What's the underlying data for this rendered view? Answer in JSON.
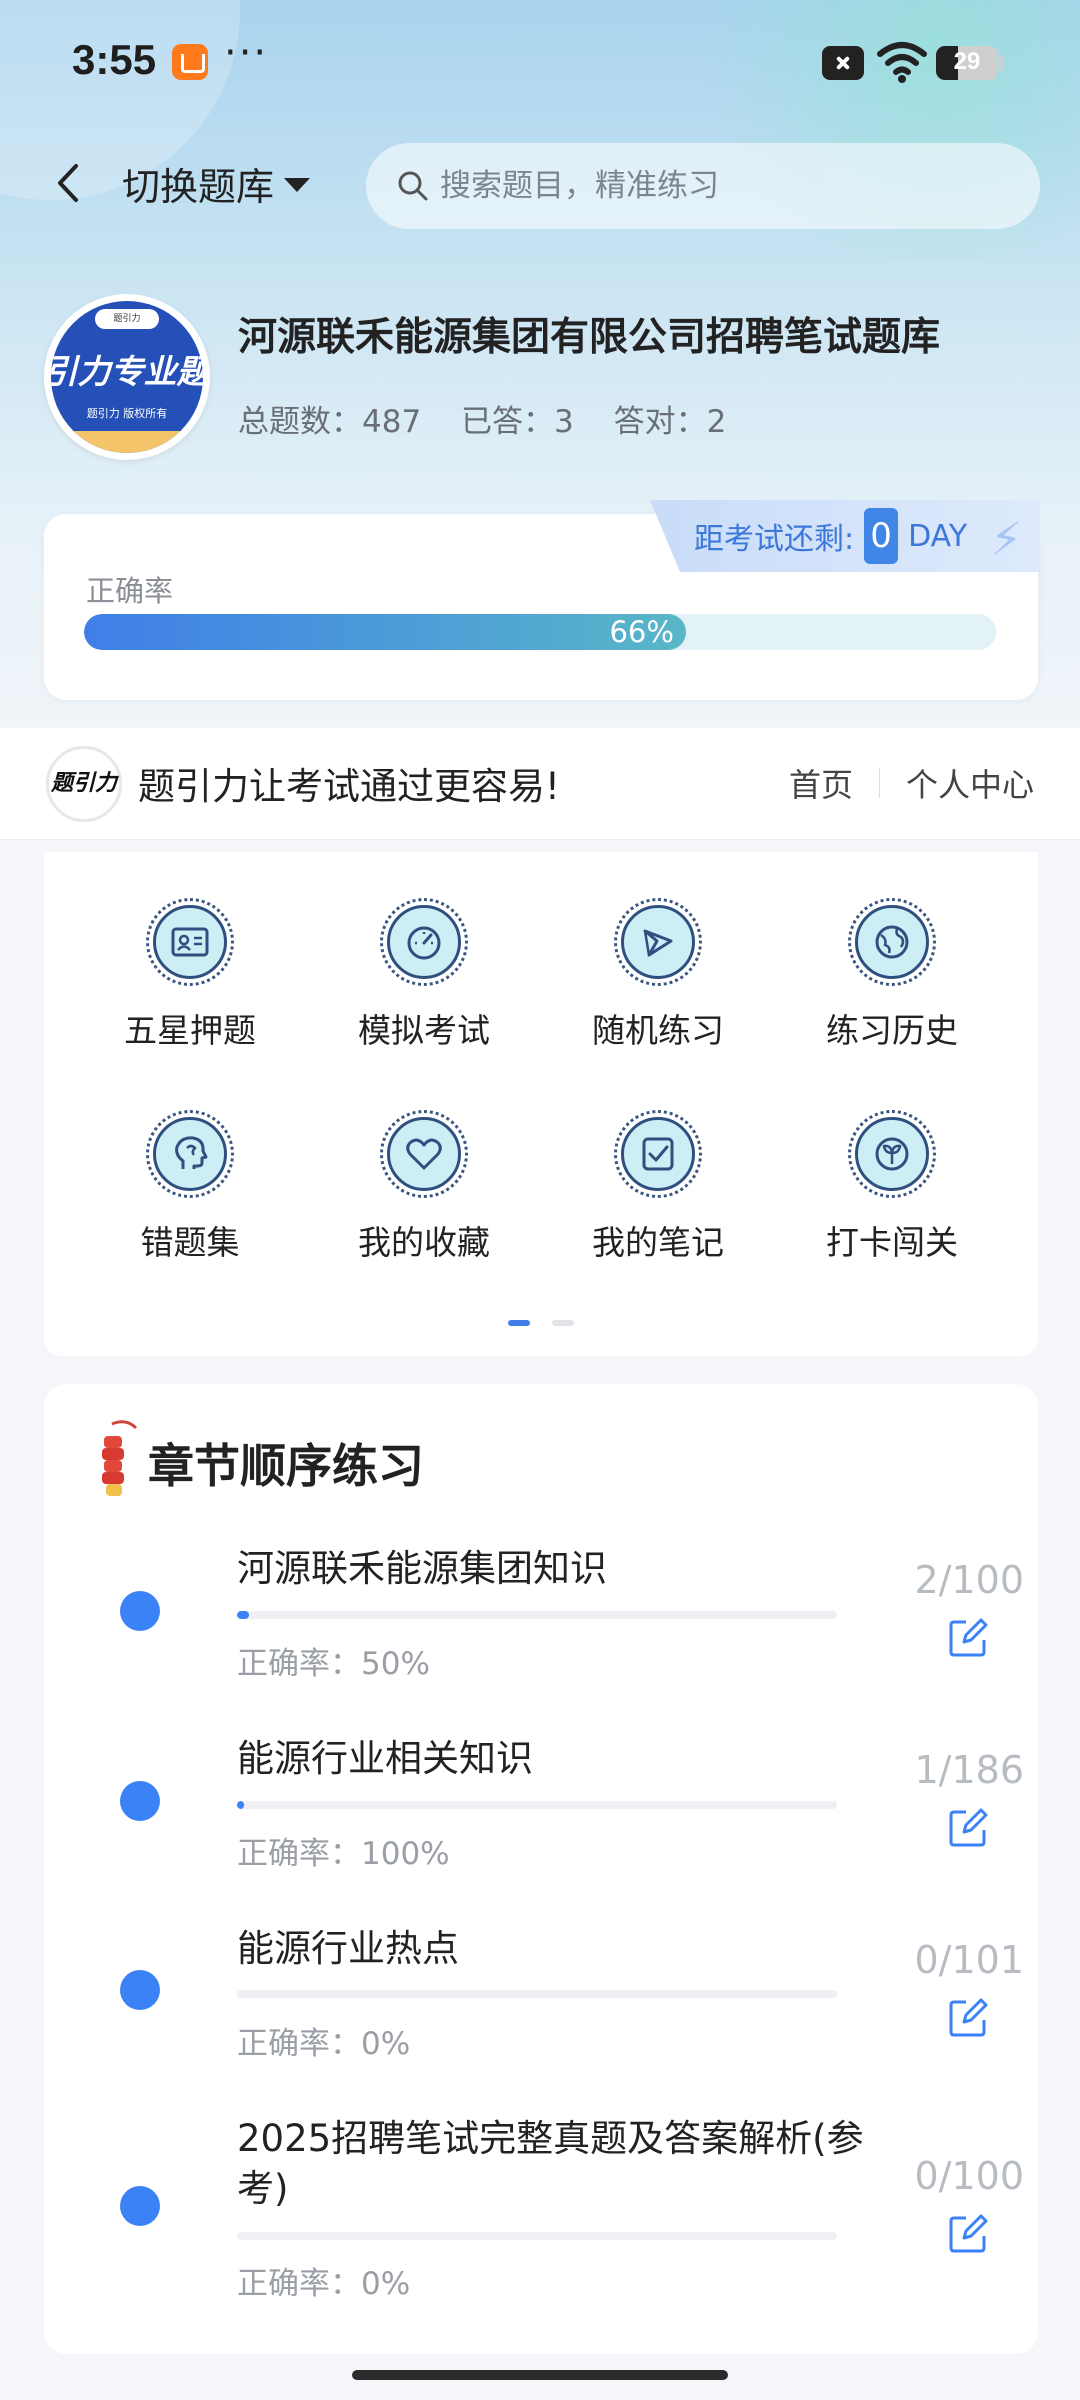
{
  "status_bar": {
    "time": "3:55",
    "battery": "29"
  },
  "header": {
    "back_icon": "chevron-left-icon",
    "switch_label": "切换题库",
    "search_placeholder": "搜索题目，精准练习"
  },
  "bank": {
    "logo_top": "题引力",
    "logo_text": "引力专业题",
    "logo_sub": "题引力 版权所有",
    "title": "河源联禾能源集团有限公司招聘笔试题库",
    "total": "总题数：487",
    "answered": "已答：3",
    "correct": "答对：2"
  },
  "accuracy": {
    "label": "正确率",
    "value": 0.66,
    "text": "66%"
  },
  "countdown": {
    "prefix": "距考试还剩:",
    "days": "0",
    "unit": "DAY"
  },
  "slogan": {
    "logo_text": "题引力",
    "text": "题引力让考试通过更容易!",
    "nav_home": "首页",
    "nav_profile": "个人中心"
  },
  "features": [
    {
      "label": "五星押题",
      "icon": "id-card-icon"
    },
    {
      "label": "模拟考试",
      "icon": "speedometer-icon"
    },
    {
      "label": "随机练习",
      "icon": "shuffle-icon"
    },
    {
      "label": "练习历史",
      "icon": "globe-icon"
    },
    {
      "label": "错题集",
      "icon": "head-icon"
    },
    {
      "label": "我的收藏",
      "icon": "heart-icon"
    },
    {
      "label": "我的笔记",
      "icon": "note-check-icon"
    },
    {
      "label": "打卡闯关",
      "icon": "sprout-icon"
    }
  ],
  "chapter_section": {
    "title": "章节顺序练习"
  },
  "chapters": [
    {
      "name": "河源联禾能源集团知识",
      "count": "2/100",
      "progress": 0.02,
      "accuracy": "正确率：50%"
    },
    {
      "name": "能源行业相关知识",
      "count": "1/186",
      "progress": 0.0054,
      "accuracy": "正确率：100%"
    },
    {
      "name": "能源行业热点",
      "count": "0/101",
      "progress": 0,
      "accuracy": "正确率：0%"
    },
    {
      "name": "2025招聘笔试完整真题及答案解析(参考)",
      "count": "0/100",
      "progress": 0,
      "accuracy": "正确率：0%"
    }
  ],
  "colors": {
    "accent": "#3b82f6",
    "icon_bg": "#cdeef5",
    "icon_stroke": "#2f4f7f"
  }
}
